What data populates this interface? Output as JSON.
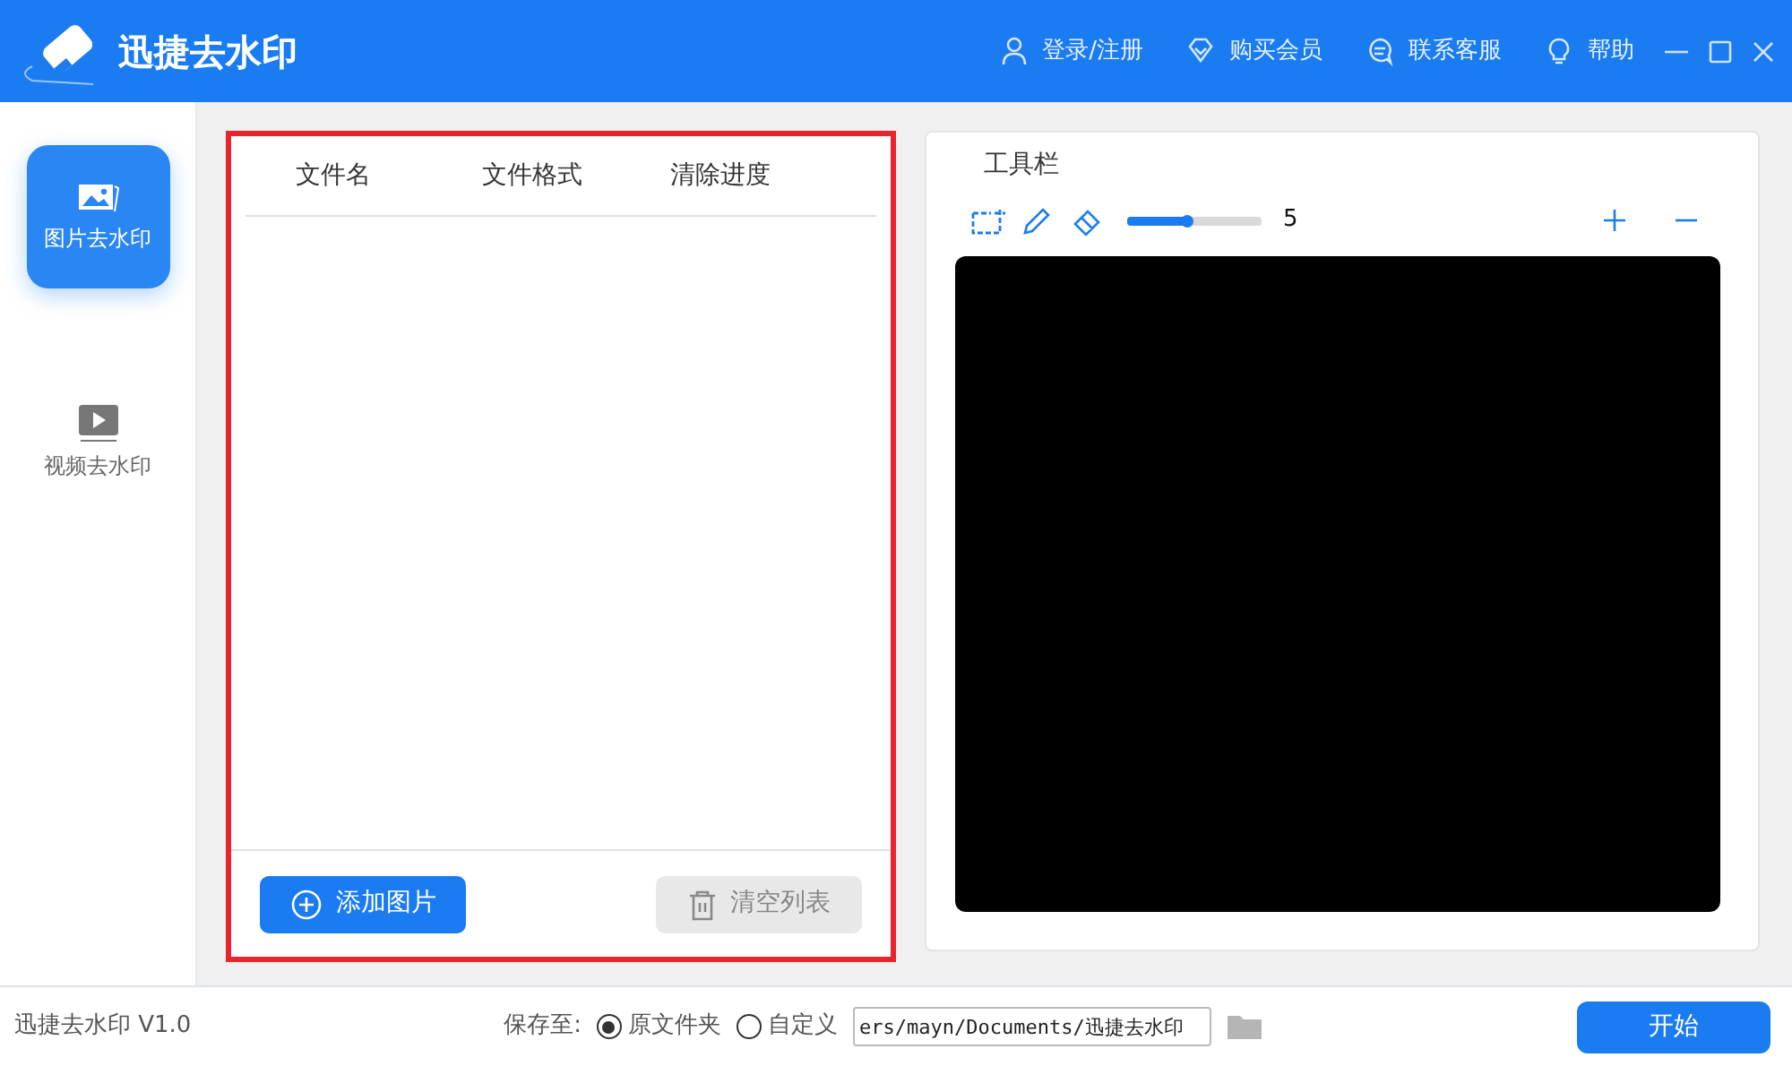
{
  "window": {
    "title": "迅捷去水印"
  },
  "header_links": [
    {
      "kind": "user",
      "label": "登录/注册"
    },
    {
      "kind": "diamond",
      "label": "购买会员"
    },
    {
      "kind": "chat",
      "label": "联系客服"
    },
    {
      "kind": "bulb",
      "label": "帮助"
    }
  ],
  "sidebar": {
    "items": [
      {
        "kind": "image",
        "label": "图片去水印",
        "selected": true
      },
      {
        "kind": "video",
        "label": "视频去水印",
        "selected": false
      }
    ]
  },
  "table": {
    "columns": [
      "文件名",
      "文件格式",
      "清除进度"
    ]
  },
  "list_buttons": [
    {
      "kind": "add",
      "label": "添加图片",
      "disabled": false
    },
    {
      "kind": "clear",
      "label": "清空列表",
      "disabled": true
    }
  ],
  "toolbar": {
    "title": "工具栏",
    "brush": {
      "level": 0.44,
      "reading": "5"
    }
  },
  "status_bar": {
    "version": "迅捷去水印 V1.0",
    "save_label": "保存至:",
    "options": [
      {
        "label": "原文件夹",
        "selected": true
      },
      {
        "label": "自定义",
        "selected": false
      }
    ],
    "path": "ers/mayn/Documents/迅捷去水印",
    "start": "开始"
  }
}
